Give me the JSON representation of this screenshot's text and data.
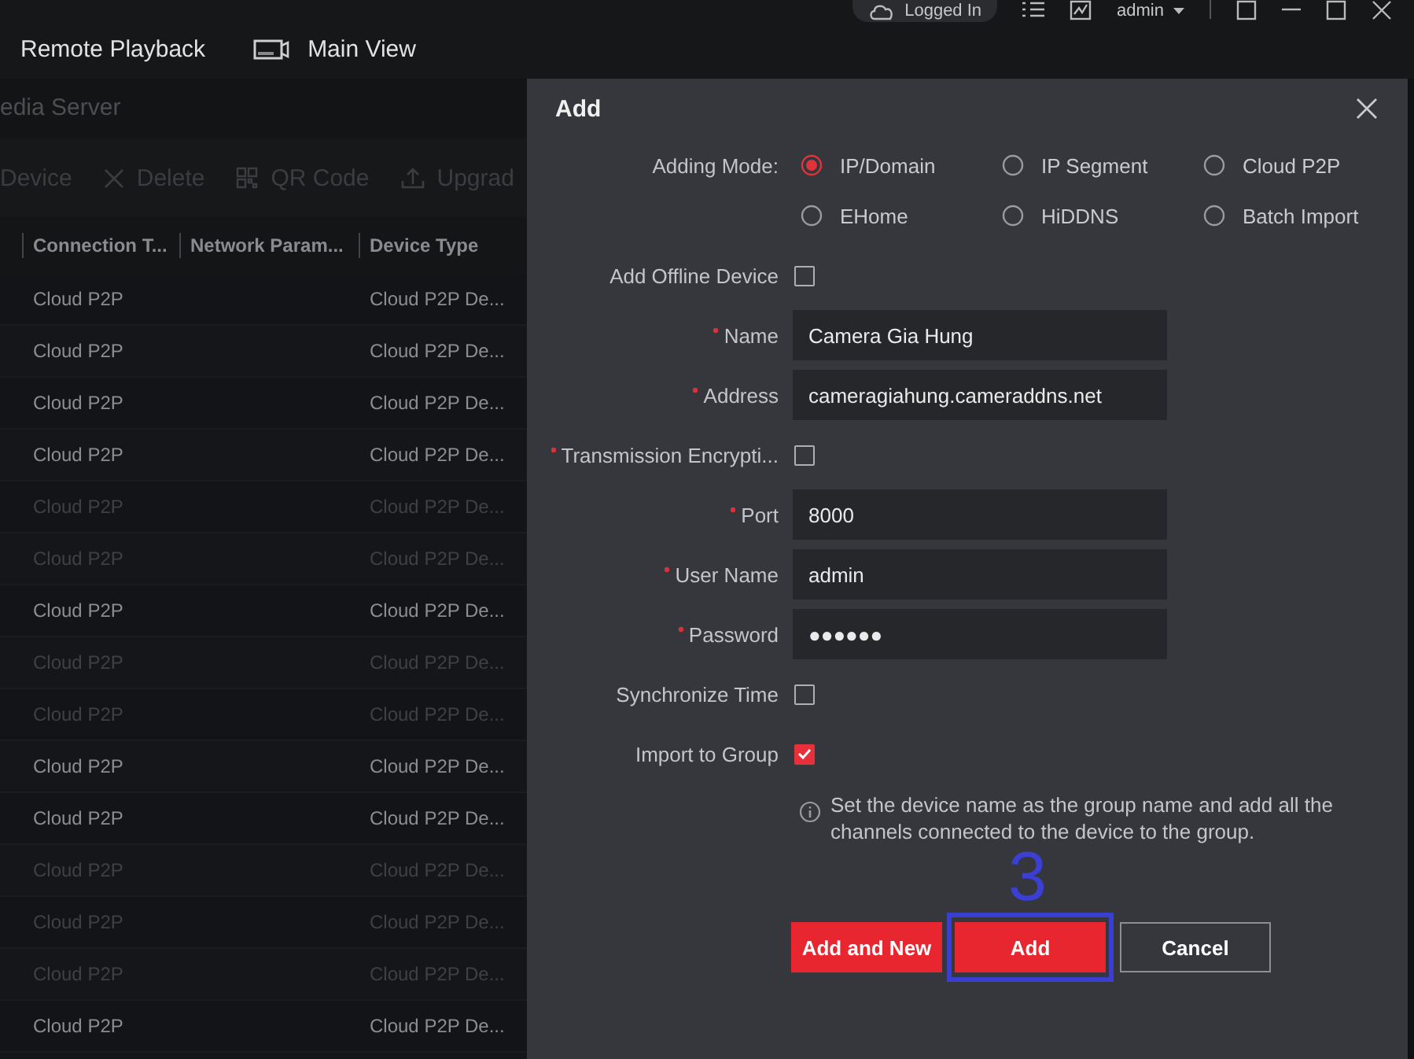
{
  "top_bar": {
    "tabs": [
      {
        "label": "Remote Playback",
        "kind": "plain"
      },
      {
        "label": "Main View",
        "kind": "camera"
      }
    ],
    "status": {
      "cloud_label": "Logged In",
      "user": "admin"
    }
  },
  "device_panel": {
    "title": "edia Server",
    "toolbar": [
      {
        "label": "Device",
        "kind": "plain"
      },
      {
        "label": "Delete",
        "kind": "delete"
      },
      {
        "label": "QR Code",
        "kind": "qr"
      },
      {
        "label": "Upgrad",
        "kind": "upload"
      }
    ],
    "columns": [
      "Connection T...",
      "Network Param...",
      "Device Type"
    ],
    "rows": [
      {
        "connection": "Cloud P2P",
        "device_type": "Cloud P2P De...",
        "dimmed": false
      },
      {
        "connection": "Cloud P2P",
        "device_type": "Cloud P2P De...",
        "dimmed": false
      },
      {
        "connection": "Cloud P2P",
        "device_type": "Cloud P2P De...",
        "dimmed": false
      },
      {
        "connection": "Cloud P2P",
        "device_type": "Cloud P2P De...",
        "dimmed": false
      },
      {
        "connection": "Cloud P2P",
        "device_type": "Cloud P2P De...",
        "dimmed": true
      },
      {
        "connection": "Cloud P2P",
        "device_type": "Cloud P2P De...",
        "dimmed": true
      },
      {
        "connection": "Cloud P2P",
        "device_type": "Cloud P2P De...",
        "dimmed": false
      },
      {
        "connection": "Cloud P2P",
        "device_type": "Cloud P2P De...",
        "dimmed": true
      },
      {
        "connection": "Cloud P2P",
        "device_type": "Cloud P2P De...",
        "dimmed": true
      },
      {
        "connection": "Cloud P2P",
        "device_type": "Cloud P2P De...",
        "dimmed": false
      },
      {
        "connection": "Cloud P2P",
        "device_type": "Cloud P2P De...",
        "dimmed": false
      },
      {
        "connection": "Cloud P2P",
        "device_type": "Cloud P2P De...",
        "dimmed": true
      },
      {
        "connection": "Cloud P2P",
        "device_type": "Cloud P2P De...",
        "dimmed": true
      },
      {
        "connection": "Cloud P2P",
        "device_type": "Cloud P2P De...",
        "dimmed": true
      },
      {
        "connection": "Cloud P2P",
        "device_type": "Cloud P2P De...",
        "dimmed": false
      }
    ]
  },
  "dialog": {
    "title": "Add",
    "adding_mode": {
      "label": "Adding Mode:",
      "options": [
        {
          "label": "IP/Domain",
          "selected": true
        },
        {
          "label": "IP Segment",
          "selected": false
        },
        {
          "label": "Cloud P2P",
          "selected": false
        },
        {
          "label": "EHome",
          "selected": false
        },
        {
          "label": "HiDDNS",
          "selected": false
        },
        {
          "label": "Batch Import",
          "selected": false
        }
      ]
    },
    "fields": [
      {
        "kind": "checkbox",
        "label": "Add Offline Device",
        "required": false,
        "checked": false
      },
      {
        "kind": "text",
        "label": "Name",
        "required": true,
        "value": "Camera Gia Hung"
      },
      {
        "kind": "text",
        "label": "Address",
        "required": true,
        "value": "cameragiahung.cameraddns.net"
      },
      {
        "kind": "checkbox",
        "label": "Transmission Encrypti...",
        "required": true,
        "checked": false
      },
      {
        "kind": "text",
        "label": "Port",
        "required": true,
        "value": "8000"
      },
      {
        "kind": "text",
        "label": "User Name",
        "required": true,
        "value": "admin"
      },
      {
        "kind": "text",
        "label": "Password",
        "required": true,
        "value": "●●●●●●"
      },
      {
        "kind": "checkbox",
        "label": "Synchronize Time",
        "required": false,
        "checked": false
      },
      {
        "kind": "checkbox",
        "label": "Import to Group",
        "required": false,
        "checked": true
      }
    ],
    "info": "Set the device name as the group name and add all the channels connected to the device to the group.",
    "buttons": [
      {
        "label": "Add and New",
        "kind": "primary",
        "highlighted": false
      },
      {
        "label": "Add",
        "kind": "primary",
        "highlighted": true
      },
      {
        "label": "Cancel",
        "kind": "secondary",
        "highlighted": false
      }
    ],
    "annotation": {
      "step": "3"
    }
  }
}
